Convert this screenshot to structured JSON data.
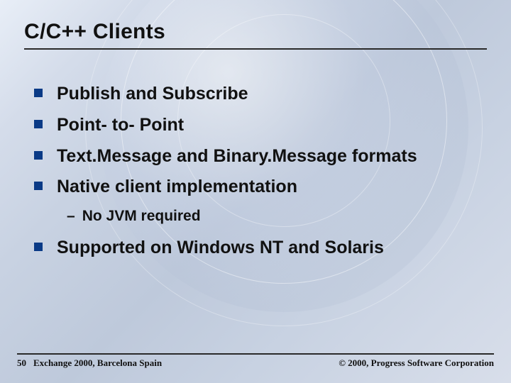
{
  "title": "C/C++ Clients",
  "bullets": [
    {
      "text": "Publish and Subscribe",
      "sub": []
    },
    {
      "text": "Point- to- Point",
      "sub": []
    },
    {
      "text": "Text.Message and Binary.Message formats",
      "sub": []
    },
    {
      "text": "Native client implementation",
      "sub": [
        "No JVM required"
      ]
    },
    {
      "text": "Supported on Windows NT and Solaris",
      "sub": []
    }
  ],
  "footer": {
    "page": "50",
    "event": "Exchange 2000, Barcelona Spain",
    "copyright": "© 2000, Progress Software Corporation"
  }
}
